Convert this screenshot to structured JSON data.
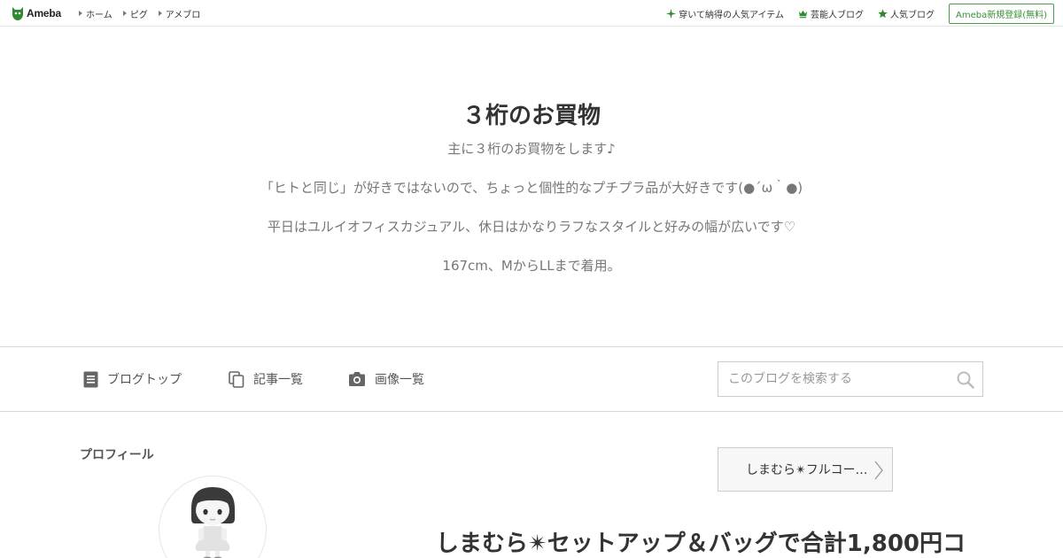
{
  "header": {
    "logo_text": "Ameba",
    "nav": [
      {
        "label": "ホーム"
      },
      {
        "label": "ピグ"
      },
      {
        "label": "アメブロ"
      }
    ],
    "right_links": [
      {
        "label": "穿いて納得の人気アイテム",
        "icon": "sparkle-icon"
      },
      {
        "label": "芸能人ブログ",
        "icon": "crown-icon"
      },
      {
        "label": "人気ブログ",
        "icon": "star-icon"
      }
    ],
    "signup_label": "Ameba新規登録(無料)"
  },
  "blog": {
    "title": "３桁のお買物",
    "description": [
      "主に３桁のお買物をします♪",
      "「ヒトと同じ」が好きではないので、ちょっと個性的なプチプラ品が大好きです(●´ω｀●)",
      "平日はユルイオフィスカジュアル、休日はかなりラフなスタイルと好みの幅が広いです♡",
      "167cm、MからLLまで着用。"
    ]
  },
  "blog_nav": {
    "items": [
      {
        "label": "ブログトップ",
        "icon": "document-icon"
      },
      {
        "label": "記事一覧",
        "icon": "copy-icon"
      },
      {
        "label": "画像一覧",
        "icon": "camera-icon"
      }
    ],
    "search_placeholder": "このブログを検索する"
  },
  "sidebar": {
    "profile_label": "プロフィール"
  },
  "main": {
    "prev_article_label": "しまむら✴︎フルコー…",
    "article_title": "しまむら✴︎セットアップ＆バッグで合計1,800円コ"
  },
  "colors": {
    "accent_green": "#2d8a2d",
    "text": "#333333",
    "muted": "#777777",
    "border": "#d8d8d8"
  }
}
